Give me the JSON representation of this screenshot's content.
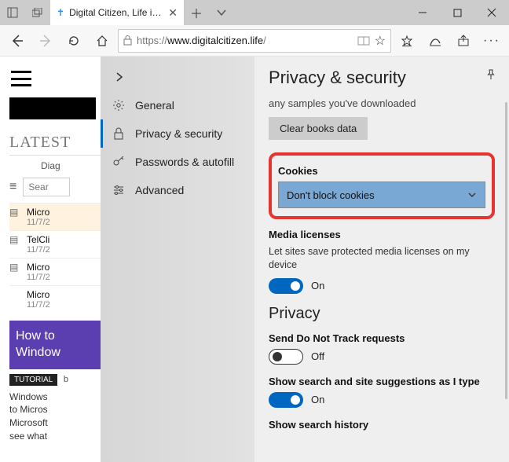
{
  "titlebar": {
    "tab_title": "Digital Citizen, Life in a"
  },
  "address": {
    "scheme": "https://",
    "host": "www.digitalcitizen.life",
    "path": "/"
  },
  "page": {
    "latest_heading": "LATEST",
    "diag_label": "Diag",
    "search_placeholder": "Sear",
    "articles": [
      {
        "title": "Micro",
        "date": "11/7/2"
      },
      {
        "title": "TelCli",
        "date": "11/7/2"
      },
      {
        "title": "Micro",
        "date": "11/7/2"
      },
      {
        "title": "Micro",
        "date": "11/7/2"
      }
    ],
    "hero_line1": "How to",
    "hero_line2": "Window",
    "tutorial_badge": "TUTORIAL",
    "tutorial_by": "b",
    "paragraph": "Windows\nto Micros\nMicrosoft\nsee what"
  },
  "sidebar": {
    "items": [
      {
        "label": "General"
      },
      {
        "label": "Privacy & security"
      },
      {
        "label": "Passwords & autofill"
      },
      {
        "label": "Advanced"
      }
    ]
  },
  "detail": {
    "title": "Privacy & security",
    "samples_text": "any samples you've downloaded",
    "clear_books_btn": "Clear books data",
    "cookies_heading": "Cookies",
    "cookies_value": "Don't block cookies",
    "media_heading": "Media licenses",
    "media_desc": "Let sites save protected media licenses on my device",
    "media_state": "On",
    "privacy_heading": "Privacy",
    "dnt_heading": "Send Do Not Track requests",
    "dnt_state": "Off",
    "suggest_heading": "Show search and site suggestions as I type",
    "suggest_state": "On",
    "history_heading": "Show search history"
  }
}
